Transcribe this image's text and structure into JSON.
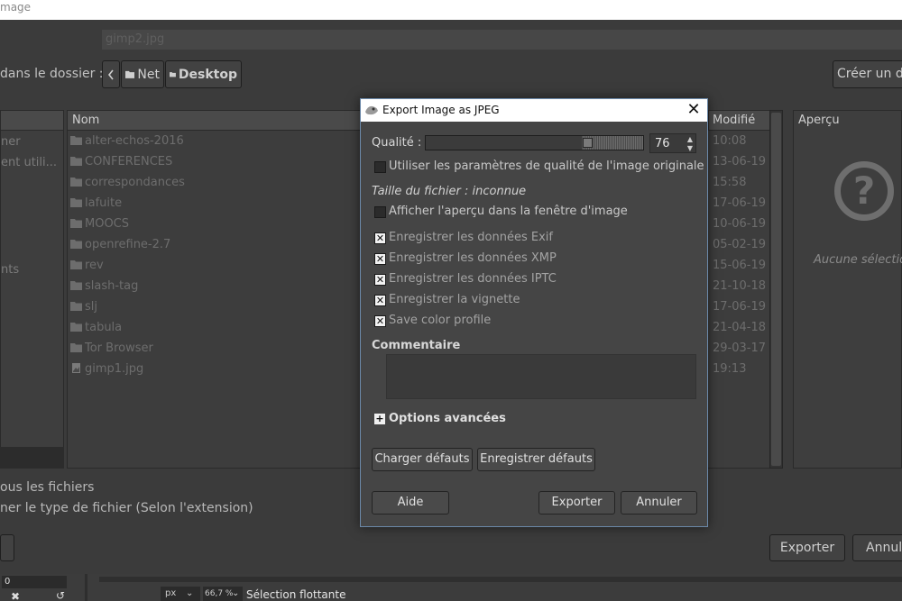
{
  "window": {
    "title": "mage"
  },
  "file_dialog": {
    "name_value": "gimp2.jpg",
    "save_in_label": "dans le dossier :",
    "path": [
      "Net",
      "Desktop"
    ],
    "create_folder_label": "Créer un do",
    "places": [
      "ner",
      "ent utili...",
      "nts"
    ],
    "columns": {
      "name": "Nom",
      "modified": "Modifié"
    },
    "files": [
      {
        "name": "alter-echos-2016",
        "modified": "10:08",
        "type": "folder"
      },
      {
        "name": "CONFERENCES",
        "modified": "13-06-19",
        "type": "folder"
      },
      {
        "name": "correspondances",
        "modified": "15:58",
        "type": "folder"
      },
      {
        "name": "lafuite",
        "modified": "17-06-19",
        "type": "folder"
      },
      {
        "name": "MOOCS",
        "modified": "10-06-19",
        "type": "folder"
      },
      {
        "name": "openrefine-2.7",
        "modified": "05-02-19",
        "type": "folder"
      },
      {
        "name": "rev",
        "modified": "15-06-19",
        "type": "folder"
      },
      {
        "name": "slash-tag",
        "modified": "21-10-18",
        "type": "folder"
      },
      {
        "name": "slj",
        "modified": "17-06-19",
        "type": "folder"
      },
      {
        "name": "tabula",
        "modified": "21-04-18",
        "type": "folder"
      },
      {
        "name": "Tor Browser",
        "modified": "29-03-17",
        "type": "folder"
      },
      {
        "name": "gimp1.jpg",
        "modified": "19:13",
        "type": "image"
      }
    ],
    "preview_title": "Aperçu",
    "preview_none": "Aucune sélection",
    "all_files": "ous les fichiers",
    "file_type": "ner le type de fichier (Selon l'extension)",
    "export_label": "Exporter",
    "cancel_label": "Annuler"
  },
  "status_bar": {
    "field_value": "0",
    "unit": "px",
    "zoom": "66,7 %",
    "message": "Sélection flottante"
  },
  "jpeg_dialog": {
    "title": "Export Image as JPEG",
    "quality_label": "Qualité :",
    "quality_value": "76",
    "use_original_quality_label": "Utiliser les paramètres de qualité de l'image originale",
    "use_original_quality": false,
    "file_size": "Taille du fichier : inconnue",
    "show_preview_label": "Afficher l'aperçu dans la fenêtre d'image",
    "show_preview": false,
    "save_exif_label": "Enregistrer les données Exif",
    "save_exif": true,
    "save_xmp_label": "Enregistrer les données XMP",
    "save_xmp": true,
    "save_iptc_label": "Enregistrer les données IPTC",
    "save_iptc": true,
    "save_thumbnail_label": "Enregistrer la vignette",
    "save_thumbnail": true,
    "save_color_profile_label": "Save color profile",
    "save_color_profile": true,
    "comment_title": "Commentaire",
    "comment_value": "",
    "advanced_label": "Options avancées",
    "load_defaults_label": "Charger défauts",
    "save_defaults_label": "Enregistrer défauts",
    "help_label": "Aide",
    "export_label": "Exporter",
    "cancel_label": "Annuler"
  },
  "icons": {
    "folder": "folder-icon",
    "image": "image-file-icon",
    "checked": "check-mark",
    "advanced": "plus-icon"
  }
}
